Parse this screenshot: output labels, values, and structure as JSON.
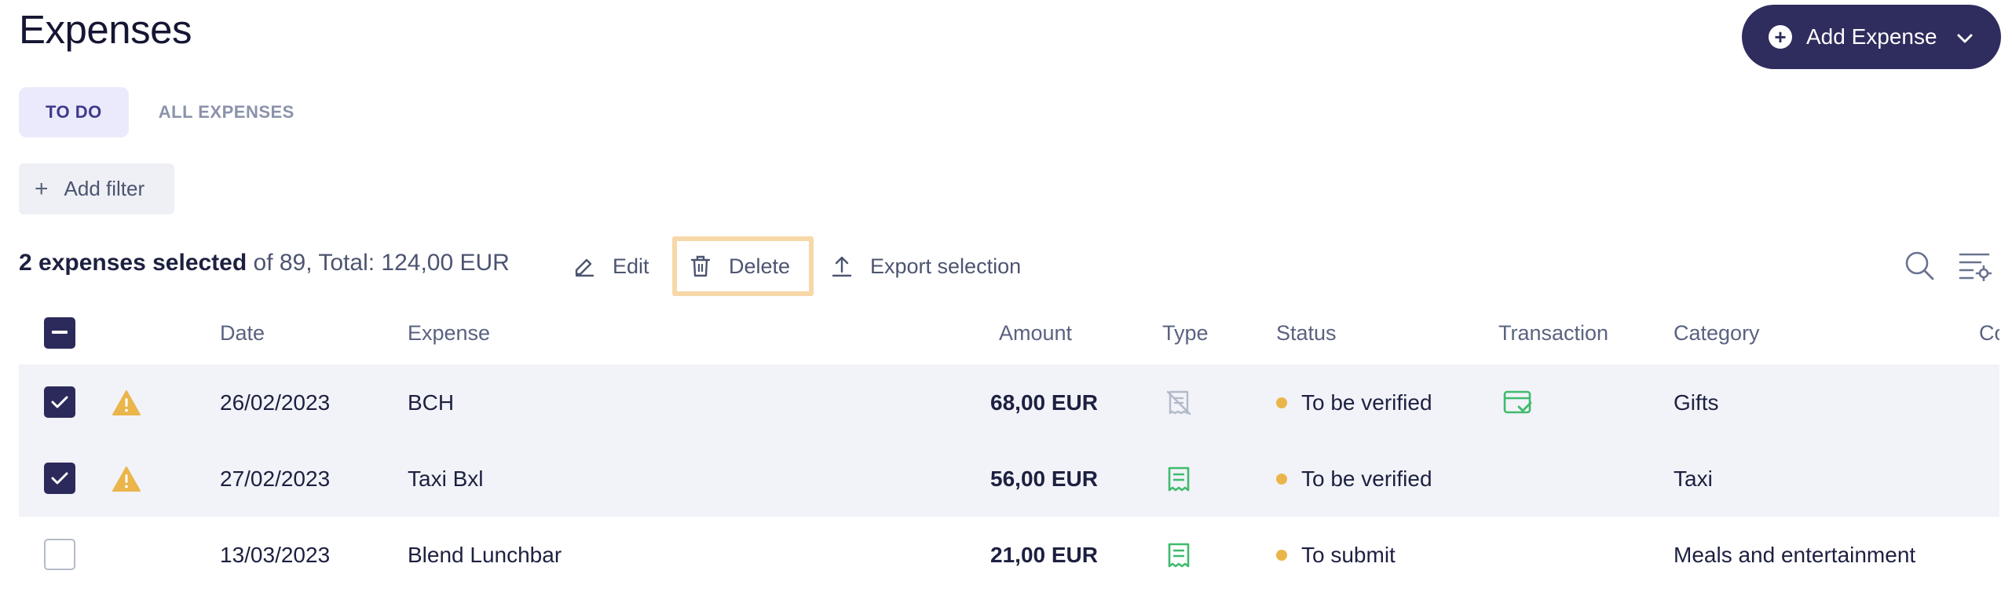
{
  "header": {
    "title": "Expenses",
    "add_expense_label": "Add Expense"
  },
  "tabs": [
    {
      "label": "TO DO",
      "active": true
    },
    {
      "label": "ALL EXPENSES",
      "active": false
    }
  ],
  "filters": {
    "add_filter_label": "Add filter"
  },
  "selection": {
    "bold_text": "2 expenses selected",
    "rest_text": " of 89, Total: 124,00 EUR"
  },
  "actions": {
    "edit_label": "Edit",
    "delete_label": "Delete",
    "export_label": "Export selection"
  },
  "columns": {
    "date": "Date",
    "expense": "Expense",
    "amount": "Amount",
    "type": "Type",
    "status": "Status",
    "transaction": "Transaction",
    "category": "Category",
    "cost_center": "Co"
  },
  "rows": [
    {
      "checked": true,
      "warning": true,
      "date": "26/02/2023",
      "expense": "BCH",
      "amount": "68,00 EUR",
      "type_icon": "no-receipt-icon",
      "status": "To be verified",
      "transaction_icon": "transaction-matched-icon",
      "category": "Gifts"
    },
    {
      "checked": true,
      "warning": true,
      "date": "27/02/2023",
      "expense": "Taxi Bxl",
      "amount": "56,00 EUR",
      "type_icon": "receipt-icon",
      "status": "To be verified",
      "transaction_icon": "",
      "category": "Taxi"
    },
    {
      "checked": false,
      "warning": false,
      "date": "13/03/2023",
      "expense": "Blend Lunchbar",
      "amount": "21,00 EUR",
      "type_icon": "receipt-icon",
      "status": "To submit",
      "transaction_icon": "",
      "category": "Meals and entertainment"
    }
  ],
  "colors": {
    "primary": "#2f2c5e",
    "warning": "#eab54a",
    "receipt_green": "#3fba6e",
    "highlight": "#f7d8a8"
  }
}
